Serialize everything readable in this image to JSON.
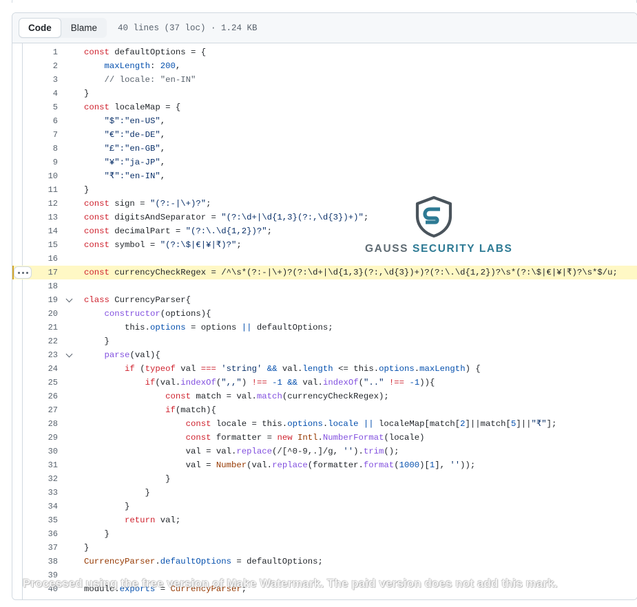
{
  "header": {
    "tabs": [
      {
        "id": "code",
        "label": "Code",
        "active": true
      },
      {
        "id": "blame",
        "label": "Blame",
        "active": false
      }
    ],
    "meta": "40 lines (37 loc) · 1.24 KB"
  },
  "code": {
    "highlight_line": 17,
    "kebab_line": 17,
    "fold_lines": [
      19,
      23
    ],
    "lines": [
      {
        "n": 1,
        "tokens": [
          {
            "t": "const ",
            "c": "kw"
          },
          {
            "t": "defaultOptions = {",
            "c": "txt"
          }
        ]
      },
      {
        "n": 2,
        "tokens": [
          {
            "t": "    ",
            "c": "txt"
          },
          {
            "t": "maxLength",
            "c": "var"
          },
          {
            "t": ": ",
            "c": "txt"
          },
          {
            "t": "200",
            "c": "var"
          },
          {
            "t": ",",
            "c": "txt"
          }
        ]
      },
      {
        "n": 3,
        "tokens": [
          {
            "t": "    // locale: \"en-IN\"",
            "c": "cm"
          }
        ]
      },
      {
        "n": 4,
        "tokens": [
          {
            "t": "}",
            "c": "txt"
          }
        ]
      },
      {
        "n": 5,
        "tokens": [
          {
            "t": "const ",
            "c": "kw"
          },
          {
            "t": "localeMap = {",
            "c": "txt"
          }
        ]
      },
      {
        "n": 6,
        "tokens": [
          {
            "t": "    ",
            "c": "txt"
          },
          {
            "t": "\"$\":\"en-US\"",
            "c": "str"
          },
          {
            "t": ",",
            "c": "txt"
          }
        ]
      },
      {
        "n": 7,
        "tokens": [
          {
            "t": "    ",
            "c": "txt"
          },
          {
            "t": "\"€\":\"de-DE\"",
            "c": "str"
          },
          {
            "t": ",",
            "c": "txt"
          }
        ]
      },
      {
        "n": 8,
        "tokens": [
          {
            "t": "    ",
            "c": "txt"
          },
          {
            "t": "\"£\":\"en-GB\"",
            "c": "str"
          },
          {
            "t": ",",
            "c": "txt"
          }
        ]
      },
      {
        "n": 9,
        "tokens": [
          {
            "t": "    ",
            "c": "txt"
          },
          {
            "t": "\"¥\":\"ja-JP\"",
            "c": "str"
          },
          {
            "t": ",",
            "c": "txt"
          }
        ]
      },
      {
        "n": 10,
        "tokens": [
          {
            "t": "    ",
            "c": "txt"
          },
          {
            "t": "\"₹\":\"en-IN\"",
            "c": "str"
          },
          {
            "t": ",",
            "c": "txt"
          }
        ]
      },
      {
        "n": 11,
        "tokens": [
          {
            "t": "}",
            "c": "txt"
          }
        ]
      },
      {
        "n": 12,
        "tokens": [
          {
            "t": "const ",
            "c": "kw"
          },
          {
            "t": "sign = ",
            "c": "txt"
          },
          {
            "t": "\"(?:-|\\+)?\"",
            "c": "str"
          },
          {
            "t": ";",
            "c": "txt"
          }
        ]
      },
      {
        "n": 13,
        "tokens": [
          {
            "t": "const ",
            "c": "kw"
          },
          {
            "t": "digitsAndSeparator = ",
            "c": "txt"
          },
          {
            "t": "\"(?:\\d+|\\d{1,3}(?:,\\d{3})+)\"",
            "c": "str"
          },
          {
            "t": ";",
            "c": "txt"
          }
        ]
      },
      {
        "n": 14,
        "tokens": [
          {
            "t": "const ",
            "c": "kw"
          },
          {
            "t": "decimalPart = ",
            "c": "txt"
          },
          {
            "t": "\"(?:\\.\\d{1,2})?\"",
            "c": "str"
          },
          {
            "t": ";",
            "c": "txt"
          }
        ]
      },
      {
        "n": 15,
        "tokens": [
          {
            "t": "const ",
            "c": "kw"
          },
          {
            "t": "symbol = ",
            "c": "txt"
          },
          {
            "t": "\"(?:\\$|€|¥|₹)?\"",
            "c": "str"
          },
          {
            "t": ";",
            "c": "txt"
          }
        ]
      },
      {
        "n": 16,
        "tokens": []
      },
      {
        "n": 17,
        "tokens": [
          {
            "t": "const ",
            "c": "kw"
          },
          {
            "t": "currencyCheckRegex = /^\\s*(?:-|\\+)?(?:\\d+|\\d{1,3}(?:,\\d{3})+)?(?:\\.\\d{1,2})?\\s*(?:\\$|€|¥|₹)?\\s*$/u;",
            "c": "txt"
          }
        ]
      },
      {
        "n": 18,
        "tokens": []
      },
      {
        "n": 19,
        "tokens": [
          {
            "t": "class ",
            "c": "kw"
          },
          {
            "t": "CurrencyParser{",
            "c": "txt"
          }
        ]
      },
      {
        "n": 20,
        "tokens": [
          {
            "t": "    ",
            "c": "txt"
          },
          {
            "t": "constructor",
            "c": "fn"
          },
          {
            "t": "(options){",
            "c": "txt"
          }
        ]
      },
      {
        "n": 21,
        "tokens": [
          {
            "t": "        this.",
            "c": "txt"
          },
          {
            "t": "options",
            "c": "var"
          },
          {
            "t": " = options ",
            "c": "txt"
          },
          {
            "t": "||",
            "c": "op"
          },
          {
            "t": " defaultOptions;",
            "c": "txt"
          }
        ]
      },
      {
        "n": 22,
        "tokens": [
          {
            "t": "    }",
            "c": "txt"
          }
        ]
      },
      {
        "n": 23,
        "tokens": [
          {
            "t": "    ",
            "c": "txt"
          },
          {
            "t": "parse",
            "c": "fn"
          },
          {
            "t": "(val){",
            "c": "txt"
          }
        ]
      },
      {
        "n": 24,
        "tokens": [
          {
            "t": "        ",
            "c": "txt"
          },
          {
            "t": "if",
            "c": "kw"
          },
          {
            "t": " (",
            "c": "txt"
          },
          {
            "t": "typeof",
            "c": "kw"
          },
          {
            "t": " val ",
            "c": "txt"
          },
          {
            "t": "===",
            "c": "kw"
          },
          {
            "t": " ",
            "c": "txt"
          },
          {
            "t": "'string'",
            "c": "str"
          },
          {
            "t": " ",
            "c": "txt"
          },
          {
            "t": "&&",
            "c": "op"
          },
          {
            "t": " val.",
            "c": "txt"
          },
          {
            "t": "length",
            "c": "var"
          },
          {
            "t": " <= this.",
            "c": "txt"
          },
          {
            "t": "options",
            "c": "var"
          },
          {
            "t": ".",
            "c": "txt"
          },
          {
            "t": "maxLength",
            "c": "var"
          },
          {
            "t": ") {",
            "c": "txt"
          }
        ]
      },
      {
        "n": 25,
        "tokens": [
          {
            "t": "            ",
            "c": "txt"
          },
          {
            "t": "if",
            "c": "kw"
          },
          {
            "t": "(val.",
            "c": "txt"
          },
          {
            "t": "indexOf",
            "c": "fn"
          },
          {
            "t": "(",
            "c": "txt"
          },
          {
            "t": "\",,\"",
            "c": "str"
          },
          {
            "t": ") ",
            "c": "txt"
          },
          {
            "t": "!==",
            "c": "kw"
          },
          {
            "t": " ",
            "c": "txt"
          },
          {
            "t": "-1",
            "c": "var"
          },
          {
            "t": " ",
            "c": "txt"
          },
          {
            "t": "&&",
            "c": "op"
          },
          {
            "t": " val.",
            "c": "txt"
          },
          {
            "t": "indexOf",
            "c": "fn"
          },
          {
            "t": "(",
            "c": "txt"
          },
          {
            "t": "\"..\"",
            "c": "str"
          },
          {
            "t": " ",
            "c": "txt"
          },
          {
            "t": "!==",
            "c": "kw"
          },
          {
            "t": " ",
            "c": "txt"
          },
          {
            "t": "-1",
            "c": "var"
          },
          {
            "t": ")){",
            "c": "txt"
          }
        ]
      },
      {
        "n": 26,
        "tokens": [
          {
            "t": "                ",
            "c": "txt"
          },
          {
            "t": "const ",
            "c": "kw"
          },
          {
            "t": "match = val.",
            "c": "txt"
          },
          {
            "t": "match",
            "c": "fn"
          },
          {
            "t": "(currencyCheckRegex);",
            "c": "txt"
          }
        ]
      },
      {
        "n": 27,
        "tokens": [
          {
            "t": "                ",
            "c": "txt"
          },
          {
            "t": "if",
            "c": "kw"
          },
          {
            "t": "(match){",
            "c": "txt"
          }
        ]
      },
      {
        "n": 28,
        "tokens": [
          {
            "t": "                    ",
            "c": "txt"
          },
          {
            "t": "const ",
            "c": "kw"
          },
          {
            "t": "locale = this.",
            "c": "txt"
          },
          {
            "t": "options",
            "c": "var"
          },
          {
            "t": ".",
            "c": "txt"
          },
          {
            "t": "locale",
            "c": "var"
          },
          {
            "t": " ",
            "c": "txt"
          },
          {
            "t": "||",
            "c": "op"
          },
          {
            "t": " localeMap[match[",
            "c": "txt"
          },
          {
            "t": "2",
            "c": "var"
          },
          {
            "t": "]||match[",
            "c": "txt"
          },
          {
            "t": "5",
            "c": "var"
          },
          {
            "t": "]||",
            "c": "txt"
          },
          {
            "t": "\"₹\"",
            "c": "str"
          },
          {
            "t": "];",
            "c": "txt"
          }
        ]
      },
      {
        "n": 29,
        "tokens": [
          {
            "t": "                    ",
            "c": "txt"
          },
          {
            "t": "const ",
            "c": "kw"
          },
          {
            "t": "formatter = ",
            "c": "txt"
          },
          {
            "t": "new",
            "c": "kw"
          },
          {
            "t": " ",
            "c": "txt"
          },
          {
            "t": "Intl",
            "c": "cls"
          },
          {
            "t": ".",
            "c": "txt"
          },
          {
            "t": "NumberFormat",
            "c": "fn"
          },
          {
            "t": "(locale)",
            "c": "txt"
          }
        ]
      },
      {
        "n": 30,
        "tokens": [
          {
            "t": "                    val = val.",
            "c": "txt"
          },
          {
            "t": "replace",
            "c": "fn"
          },
          {
            "t": "(/[^0-9,.]/g, ",
            "c": "txt"
          },
          {
            "t": "''",
            "c": "str"
          },
          {
            "t": ").",
            "c": "txt"
          },
          {
            "t": "trim",
            "c": "fn"
          },
          {
            "t": "();",
            "c": "txt"
          }
        ]
      },
      {
        "n": 31,
        "tokens": [
          {
            "t": "                    val = ",
            "c": "txt"
          },
          {
            "t": "Number",
            "c": "cls"
          },
          {
            "t": "(val.",
            "c": "txt"
          },
          {
            "t": "replace",
            "c": "fn"
          },
          {
            "t": "(formatter.",
            "c": "txt"
          },
          {
            "t": "format",
            "c": "fn"
          },
          {
            "t": "(",
            "c": "txt"
          },
          {
            "t": "1000",
            "c": "var"
          },
          {
            "t": ")[",
            "c": "txt"
          },
          {
            "t": "1",
            "c": "var"
          },
          {
            "t": "], ",
            "c": "txt"
          },
          {
            "t": "''",
            "c": "str"
          },
          {
            "t": "));",
            "c": "txt"
          }
        ]
      },
      {
        "n": 32,
        "tokens": [
          {
            "t": "                }",
            "c": "txt"
          }
        ]
      },
      {
        "n": 33,
        "tokens": [
          {
            "t": "            }",
            "c": "txt"
          }
        ]
      },
      {
        "n": 34,
        "tokens": [
          {
            "t": "        }",
            "c": "txt"
          }
        ]
      },
      {
        "n": 35,
        "tokens": [
          {
            "t": "        ",
            "c": "txt"
          },
          {
            "t": "return",
            "c": "kw"
          },
          {
            "t": " val;",
            "c": "txt"
          }
        ]
      },
      {
        "n": 36,
        "tokens": [
          {
            "t": "    }",
            "c": "txt"
          }
        ]
      },
      {
        "n": 37,
        "tokens": [
          {
            "t": "}",
            "c": "txt"
          }
        ]
      },
      {
        "n": 38,
        "tokens": [
          {
            "t": "CurrencyParser",
            "c": "cls"
          },
          {
            "t": ".",
            "c": "txt"
          },
          {
            "t": "defaultOptions",
            "c": "var"
          },
          {
            "t": " = defaultOptions;",
            "c": "txt"
          }
        ]
      },
      {
        "n": 39,
        "tokens": []
      },
      {
        "n": 40,
        "tokens": [
          {
            "t": "module.",
            "c": "txt"
          },
          {
            "t": "exports",
            "c": "var"
          },
          {
            "t": " = ",
            "c": "txt"
          },
          {
            "t": "CurrencyParser",
            "c": "cls"
          },
          {
            "t": ";",
            "c": "txt"
          }
        ]
      }
    ]
  },
  "logo": {
    "shield_icon": "shield-with-s-icon",
    "word_part_1": "GAUSS",
    "word_part_2": "SECURITY LABS",
    "color_gray": "#5f6b73",
    "color_teal": "#2d7a94"
  },
  "watermark": {
    "text": "Processed using the free version of Make Watermark. The paid version does not add this mark."
  }
}
